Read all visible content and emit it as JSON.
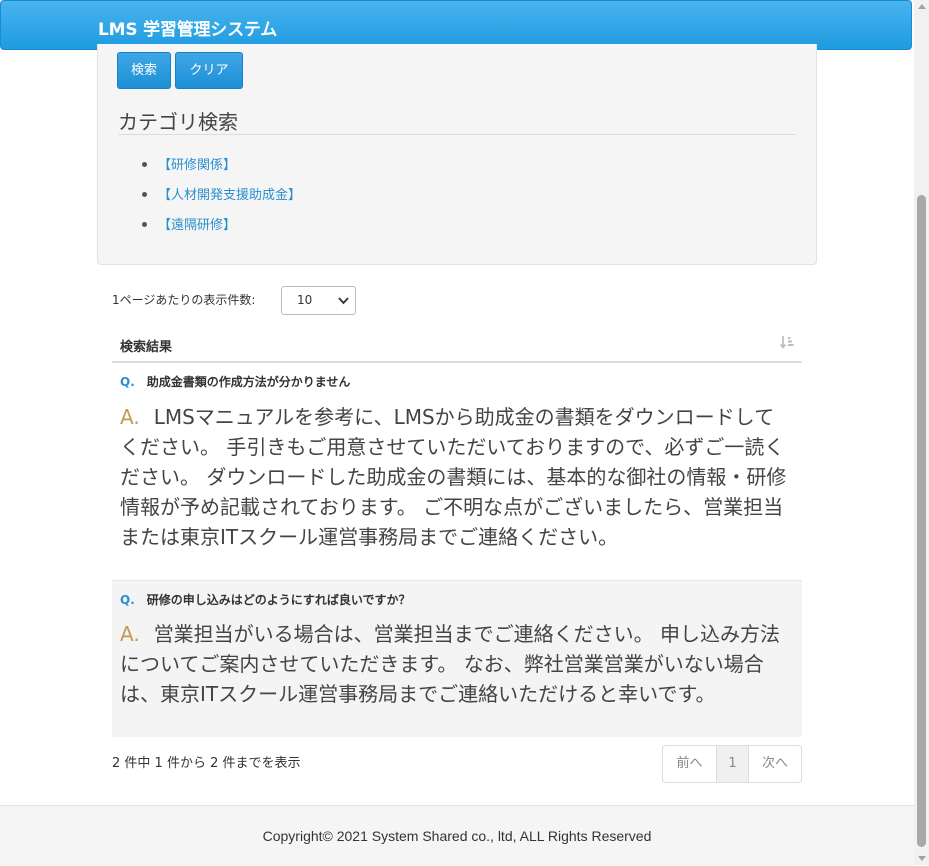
{
  "header": {
    "brand": "LMS 学習管理システム"
  },
  "search_panel": {
    "search_button": "検索",
    "clear_button": "クリア",
    "category_title": "カテゴリ検索",
    "categories": [
      {
        "label": "【研修関係】"
      },
      {
        "label": "【人材開発支援助成金】"
      },
      {
        "label": "【遠隔研修】"
      }
    ]
  },
  "per_page": {
    "label": "1ページあたりの表示件数:",
    "selected": "10"
  },
  "results": {
    "header_label": "検索結果",
    "sort_icon": "sort-amount-icon",
    "q_mark": "Q.",
    "a_mark": "A.",
    "rows": [
      {
        "question": "助成金書類の作成方法が分かりません",
        "answer": "LMSマニュアルを参考に、LMSから助成金の書類をダウンロードしてください。 手引きもご用意させていただいておりますので、必ずご一読ください。 ダウンロードした助成金の書類には、基本的な御社の情報・研修情報が予め記載されております。 ご不明な点がございましたら、営業担当または東京ITスクール運営事務局までご連絡ください。"
      },
      {
        "question": "研修の申し込みはどのようにすれば良いですか？",
        "answer": "営業担当がいる場合は、営業担当までご連絡ください。 申し込み方法についてご案内させていただきます。 なお、弊社営業営業がいない場合は、東京ITスクール運営事務局までご連絡いただけると幸いです。"
      }
    ]
  },
  "table_info": "2 件中 1 件から 2 件までを表示",
  "pagination": {
    "prev": "前へ",
    "page": "1",
    "next": "次へ"
  },
  "footer": {
    "copyright": "Copyright© 2021 System Shared co., ltd, ALL Rights Reserved"
  },
  "colors": {
    "accent": "#1f9be0",
    "link": "#2a8fd0",
    "answer_mark": "#c49a55"
  }
}
